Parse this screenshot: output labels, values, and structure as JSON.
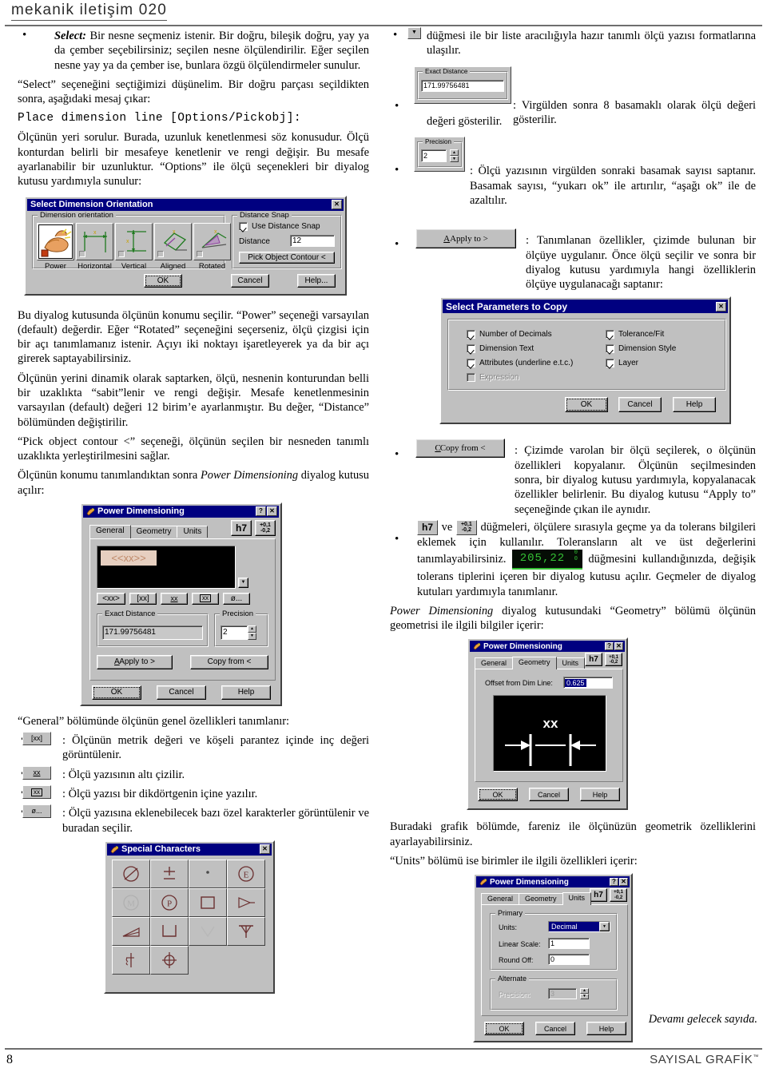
{
  "header": {
    "title": "mekanik iletişim 020"
  },
  "footer": {
    "page_number": "8",
    "brand": "SAYISAL GRAFİK",
    "trademark": "™",
    "note": "Devamı gelecek sayıda."
  },
  "left": {
    "bullet1_lead": "Select:",
    "bullet1_text": " Bir nesne seçmeniz istenir. Bir doğru, bileşik doğru, yay ya da çember seçebilirsiniz; seçilen nesne ölçülendirilir. Eğer seçilen nesne yay ya da çember ise, bunlara özgü ölçülendirmeler sunulur.",
    "para1": "“Select” seçeneğini seçtiğimizi düşünelim. Bir doğru parçası seçildikten sonra, aşağıdaki mesaj çıkar:",
    "code": "Place dimension line [Options/Pickobj]:",
    "para2": "Ölçünün yeri sorulur. Burada, uzunluk kenetlenmesi söz konusudur. Ölçü konturdan belirli bir mesafeye kenetlenir ve rengi değişir. Bu mesafe ayarlanabilir bir uzunluktur. “Options” ile ölçü seçenekleri bir diyalog kutusu yardımıyla sunulur:",
    "para3": "Bu diyalog kutusunda ölçünün konumu seçilir. “Power” seçeneği varsayılan (default) değerdir. Eğer “Rotated” seçeneğini seçerseniz, ölçü çizgisi için bir açı tanımlamanız istenir. Açıyı iki noktayı işaretleyerek ya da bir açı girerek saptayabilirsiniz.",
    "para4": "Ölçünün yerini dinamik olarak saptarken, ölçü, nesnenin konturundan belli bir uzaklıkta “sabit”lenir ve rengi değişir. Mesafe kenetlenmesinin varsayılan (default) değeri 12 birim’e ayarlanmıştır. Bu değer, “Distance” bölümünden değiştirilir.",
    "para5": "“Pick object contour <” seçeneği, ölçünün seçilen bir nesneden tanımlı uzaklıkta yerleştirilmesini sağlar.",
    "para6_a": "Ölçünün konumu tanımlandıktan sonra ",
    "para6_i": "Power Dimensioning",
    "para6_b": " diyalog kutusu açılır:",
    "para7": "“General” bölümünde ölçünün genel özellikleri tanımlanır:",
    "icon_bullets": [
      {
        "icon": "[xx]",
        "text": ": Ölçünün metrik değeri ve köşeli parantez içinde inç değeri görüntülenir."
      },
      {
        "icon": "xx",
        "text": ": Ölçü yazısının altı çizilir."
      },
      {
        "icon": "xx",
        "text": ": Ölçü yazısı bir dikdörtgenin içine yazılır."
      },
      {
        "icon": "ø...",
        "text": ": Ölçü yazısına eklenebilecek bazı özel karakterler görüntülenir ve buradan seçilir."
      }
    ]
  },
  "right": {
    "bullet_dropdown": " düğmesi ile bir liste aracılığıyla hazır tanımlı ölçü yazısı formatlarına ulaşılır.",
    "bullet_exact": ": Virgülden sonra 8 basamaklı olarak ölçü değeri gösterilir.",
    "bullet_precision": ": Ölçü yazısının virgülden sonraki basamak sayısı saptanır. Basamak sayısı, “yukarı ok” ile artırılır, “aşağı ok” ile de azaltılır.",
    "bullet_applyto": ": Tanımlanan özellikler, çizimde bulunan bir ölçüye uygulanır. Önce ölçü seçilir ve sonra bir diyalog kutusu yardımıyla hangi özelliklerin ölçüye uygulanacağı saptanır:",
    "bullet_copyfrom": ": Çizimde varolan bir ölçü seçilerek, o ölçünün özellikleri kopyalanır. Ölçünün seçilmesinden sonra, bir diyalog kutusu yardımıyla, kopyalanacak özellikler belirlenir. Bu diyalog kutusu “Apply to” seçeneğinde çıkan ile aynıdır.",
    "bullet_tol_a": " ve ",
    "bullet_tol_b": " düğmeleri, ölçülere sırasıyla geçme ya da tolerans bilgileri eklemek için kullanılır. Toleransların alt ve üst değerlerini tanımlayabilirsiniz. ",
    "bullet_tol_c": " düğmesini kullandığınızda, değişik tolerans tiplerini içeren bir diyalog kutusu açılır. Geçmeler de diyalog kutuları yardımıyla tanımlanır.",
    "para_geom_i": "Power Dimensioning",
    "para_geom_t": " diyalog kutusundaki “Geometry” bölümü ölçünün geometrisi ile ilgili bilgiler içerir:",
    "para_graphic": "Buradaki grafik bölümde, fareniz ile ölçünüzün geometrik özelliklerini ayarlayabilirsiniz.",
    "para_units": "“Units” bölümü ise birimler ile ilgili özellikleri içerir:"
  },
  "dialogs": {
    "select_dim_orientation": {
      "title": "Select Dimension Orientation",
      "close": "✕",
      "group_orientation": "Dimension orientation",
      "options": [
        {
          "label": "Power",
          "selected": true
        },
        {
          "label": "Horizontal",
          "selected": false
        },
        {
          "label": "Vertical",
          "selected": false
        },
        {
          "label": "Aligned",
          "selected": false
        },
        {
          "label": "Rotated",
          "selected": false
        }
      ],
      "group_distance_snap": "Distance Snap",
      "use_distance_snap": "Use Distance Snap",
      "use_distance_snap_checked": true,
      "distance_label": "Distance",
      "distance_value": "12",
      "pick_object_contour": "Pick Object Contour <",
      "ok": "OK",
      "cancel": "Cancel",
      "help": "Help..."
    },
    "power_dimensioning_general": {
      "title": "Power Dimensioning",
      "help_btn": "?",
      "close_btn": "✕",
      "tabs": [
        {
          "label": "General",
          "selected": true
        },
        {
          "label": "Geometry",
          "selected": false
        },
        {
          "label": "Units",
          "selected": false
        }
      ],
      "tol_fit_btn": "h7",
      "tol_btn_top": "+0,1",
      "tol_btn_bot": "-0,2",
      "preview_text": "<<xx>>",
      "format_buttons": [
        "<xx>",
        "[xx]",
        "xx",
        "xx",
        "ø..."
      ],
      "exact_distance_label": "Exact Distance",
      "exact_distance_value": "171.99756481",
      "precision_label": "Precision",
      "precision_value": "2",
      "apply_to": "Apply to >",
      "copy_from": "Copy from <",
      "ok": "OK",
      "cancel": "Cancel",
      "help": "Help"
    },
    "select_parameters_to_copy": {
      "title": "Select Parameters to Copy",
      "close": "✕",
      "checks_left": [
        {
          "label": "Number of Decimals",
          "checked": true,
          "disabled": false
        },
        {
          "label": "Dimension Text",
          "checked": true,
          "disabled": false
        },
        {
          "label": "Attributes (underline e.t.c.)",
          "checked": true,
          "disabled": false
        },
        {
          "label": "Expression",
          "checked": false,
          "disabled": true
        }
      ],
      "checks_right": [
        {
          "label": "Tolerance/Fit",
          "checked": true,
          "disabled": false
        },
        {
          "label": "Dimension Style",
          "checked": true,
          "disabled": false
        },
        {
          "label": "Layer",
          "checked": true,
          "disabled": false
        }
      ],
      "ok": "OK",
      "cancel": "Cancel",
      "help": "Help"
    },
    "power_dimensioning_geometry": {
      "title": "Power Dimensioning",
      "help_btn": "?",
      "close_btn": "✕",
      "tabs": [
        {
          "label": "General",
          "selected": false
        },
        {
          "label": "Geometry",
          "selected": true
        },
        {
          "label": "Units",
          "selected": false
        }
      ],
      "tol_fit_btn": "h7",
      "tol_btn_top": "+0,1",
      "tol_btn_bot": "-0,2",
      "offset_label": "Offset from Dim Line:",
      "offset_value": "0.625",
      "preview_text": "xx",
      "ok": "OK",
      "cancel": "Cancel",
      "help": "Help"
    },
    "power_dimensioning_units": {
      "title": "Power Dimensioning",
      "help_btn": "?",
      "close_btn": "✕",
      "tabs": [
        {
          "label": "General",
          "selected": false
        },
        {
          "label": "Geometry",
          "selected": false
        },
        {
          "label": "Units",
          "selected": true
        }
      ],
      "tol_fit_btn": "h7",
      "tol_btn_top": "+0,1",
      "tol_btn_bot": "-0,2",
      "primary_group": "Primary",
      "units_label": "Units:",
      "units_value": "Decimal",
      "linear_scale_label": "Linear Scale:",
      "linear_scale_value": "1",
      "round_off_label": "Round Off:",
      "round_off_value": "0",
      "alternate_group": "Alternate",
      "alt_precision_label": "Precision:",
      "alt_precision_value": "3",
      "ok": "OK",
      "cancel": "Cancel",
      "help": "Help"
    },
    "special_characters": {
      "title": "Special Characters",
      "close": "✕",
      "cells": [
        "diameter-slash",
        "plus-minus",
        "center-dot",
        "circled-E",
        "circled-M",
        "circled-P",
        "square",
        "arrow-flat",
        "taper",
        "counterbore",
        "countersink-v",
        "depth-t",
        "centerline",
        "position-cross"
      ]
    }
  },
  "inline_widgets": {
    "dropdown_arrow": "▼",
    "exact_distance_label": "Exact Distance",
    "exact_distance_value": "171.99756481",
    "precision_label": "Precision",
    "precision_value": "2",
    "apply_to": "Apply to >",
    "copy_from": "Copy from <",
    "tol_fit": "h7",
    "tol_top": "+0,1",
    "tol_bot": "-0,2",
    "lcd_value": "205,22",
    "lcd_sup": "0",
    "lcd_sub": "0",
    "btn_bracket": "[xx]",
    "btn_underline": "xx",
    "btn_box": "xx",
    "btn_special": "ø..."
  }
}
